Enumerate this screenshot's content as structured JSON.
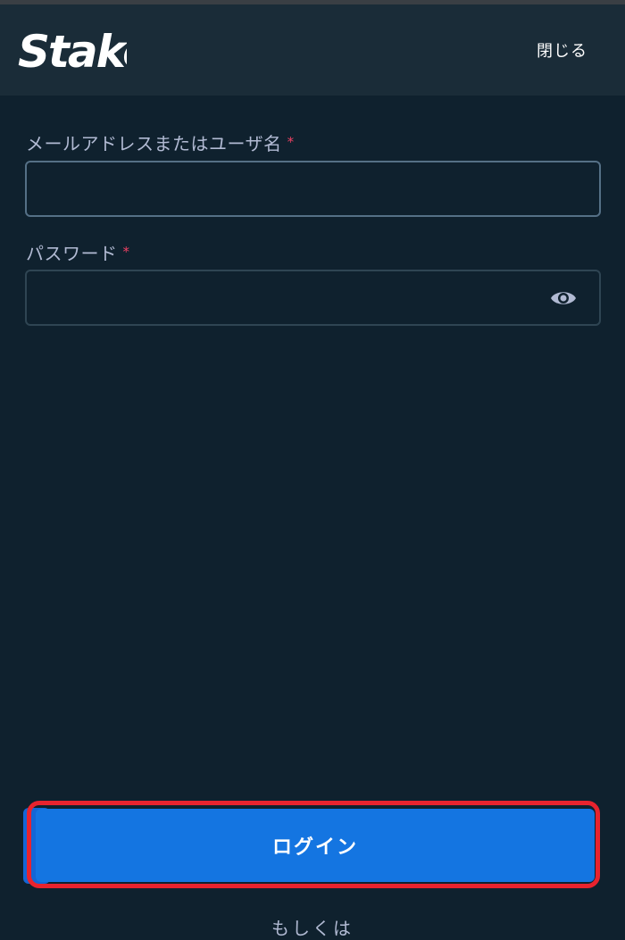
{
  "header": {
    "logo_text": "Stake",
    "close_label": "閉じる"
  },
  "form": {
    "email": {
      "label": "メールアドレスまたはユーザ名",
      "required_mark": "*",
      "value": ""
    },
    "password": {
      "label": "パスワード",
      "required_mark": "*",
      "value": "",
      "toggle_icon": "eye-icon"
    },
    "login_label": "ログイン",
    "or_label": "もしくは"
  },
  "colors": {
    "background": "#0f212e",
    "header": "#1a2c38",
    "input_border": "#2f4553",
    "primary_button": "#1475e1",
    "required": "#ed4163",
    "highlight": "#e8232e"
  }
}
